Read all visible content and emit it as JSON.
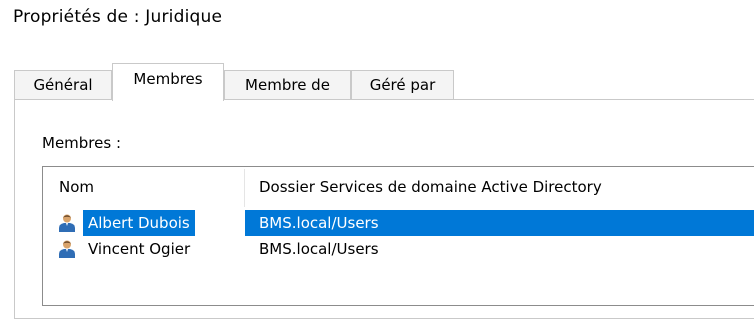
{
  "window": {
    "title": "Propriétés de : Juridique"
  },
  "tabs": [
    {
      "label": "Général",
      "active": false
    },
    {
      "label": "Membres",
      "active": true
    },
    {
      "label": "Membre de",
      "active": false
    },
    {
      "label": "Géré par",
      "active": false
    }
  ],
  "members_panel": {
    "label": "Membres :",
    "columns": [
      "Nom",
      "Dossier Services de domaine Active Directory"
    ],
    "rows": [
      {
        "name": "Albert Dubois",
        "folder": "BMS.local/Users",
        "selected": true,
        "icon": "user-icon"
      },
      {
        "name": "Vincent Ogier",
        "folder": "BMS.local/Users",
        "selected": false,
        "icon": "user-icon"
      }
    ]
  },
  "colors": {
    "selection": "#0078d7",
    "selection_text": "#ffffff",
    "icon_blue": "#2f6db5",
    "icon_skin": "#d9a46c"
  }
}
